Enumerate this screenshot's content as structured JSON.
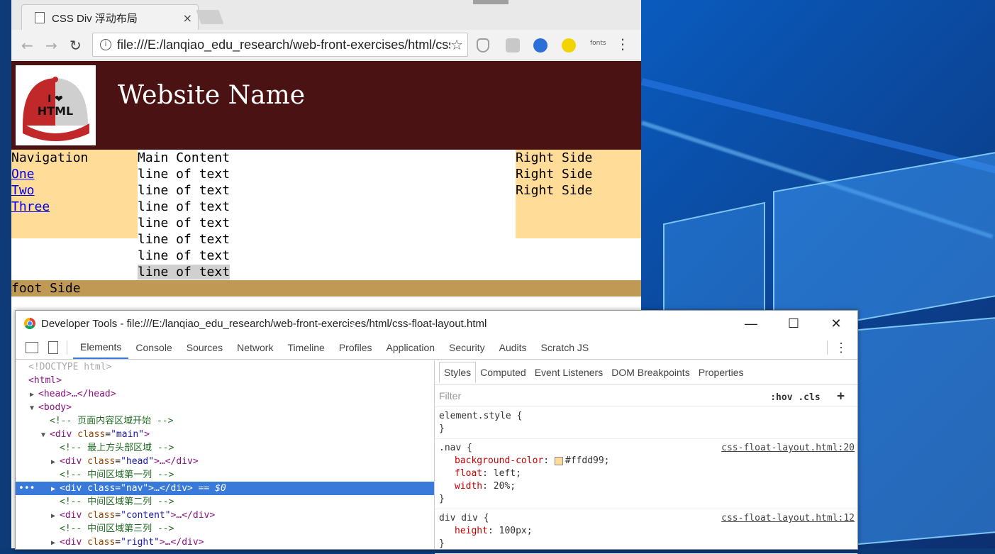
{
  "browser": {
    "tab_title": "CSS Div 浮动布局",
    "tab_close": "×",
    "url": "file:///E:/lanqiao_edu_research/web-front-exercises/html/css-float-layout.html",
    "extensions": [
      {
        "name": "shield-icon",
        "color": "#9e9e9e"
      },
      {
        "name": "es-icon",
        "color": "#c8c8c8"
      },
      {
        "name": "eye-icon",
        "color": "#2c6fd6"
      },
      {
        "name": "plus-icon",
        "color": "#f2d400"
      }
    ],
    "fonts_label": "fonts"
  },
  "page": {
    "site_name": "Website Name",
    "nav": {
      "heading": "Navigation",
      "links": [
        "One",
        "Two",
        "Three"
      ]
    },
    "main": {
      "heading": "Main Content",
      "lines": [
        "line of text",
        "line of text",
        "line of text",
        "line of text",
        "line of text",
        "line of text",
        "line of text"
      ]
    },
    "right": {
      "lines": [
        "Right Side",
        "Right Side",
        "Right Side"
      ]
    },
    "foot": "foot Side",
    "logo_text": "I ❤ HTML"
  },
  "devtools": {
    "title": "Developer Tools - file:///E:/lanqiao_edu_research/web-front-exercises/html/css-float-layout.html",
    "tabs": [
      "Elements",
      "Console",
      "Sources",
      "Network",
      "Timeline",
      "Profiles",
      "Application",
      "Security",
      "Audits",
      "Scratch JS"
    ],
    "active_tab": "Elements",
    "style_tabs": [
      "Styles",
      "Computed",
      "Event Listeners",
      "DOM Breakpoints",
      "Properties"
    ],
    "filter_placeholder": "Filter",
    "hov_cls": ":hov  .cls",
    "plus": "+",
    "rules": {
      "element_style": "element.style {",
      "close": "}",
      "nav_selector": ".nav {",
      "nav_source": "css-float-layout.html:20",
      "nav_bg_name": "background-color",
      "nav_bg_value": "#ffdd99;",
      "nav_float_name": "float",
      "nav_float_value": "left;",
      "nav_width_name": "width",
      "nav_width_value": "20%;",
      "divdiv_selector": "div div {",
      "divdiv_source": "css-float-layout.html:12",
      "divdiv_height_name": "height",
      "divdiv_height_value": "100px;"
    },
    "dom": {
      "doctype": "<!DOCTYPE html>",
      "html_open": "<html>",
      "head": "<head>…</head>",
      "body_open": "<body>",
      "c1": "<!-- 页面内容区域开始 -->",
      "main_open_tag": "<div ",
      "main_attr": "class",
      "main_val": "\"main\"",
      "c2": "<!-- 最上方头部区域 -->",
      "head_val": "\"head\"",
      "c3": "<!-- 中间区域第一列 -->",
      "nav_val": "\"nav\"",
      "sel_suffix": " == $0",
      "c4": "<!-- 中间区域第二列 -->",
      "content_val": "\"content\"",
      "c5": "<!-- 中间区域第三列 -->",
      "right_val": "\"right\"",
      "ellipsis_close": ">…</div>",
      "ellipsis": "…"
    }
  }
}
